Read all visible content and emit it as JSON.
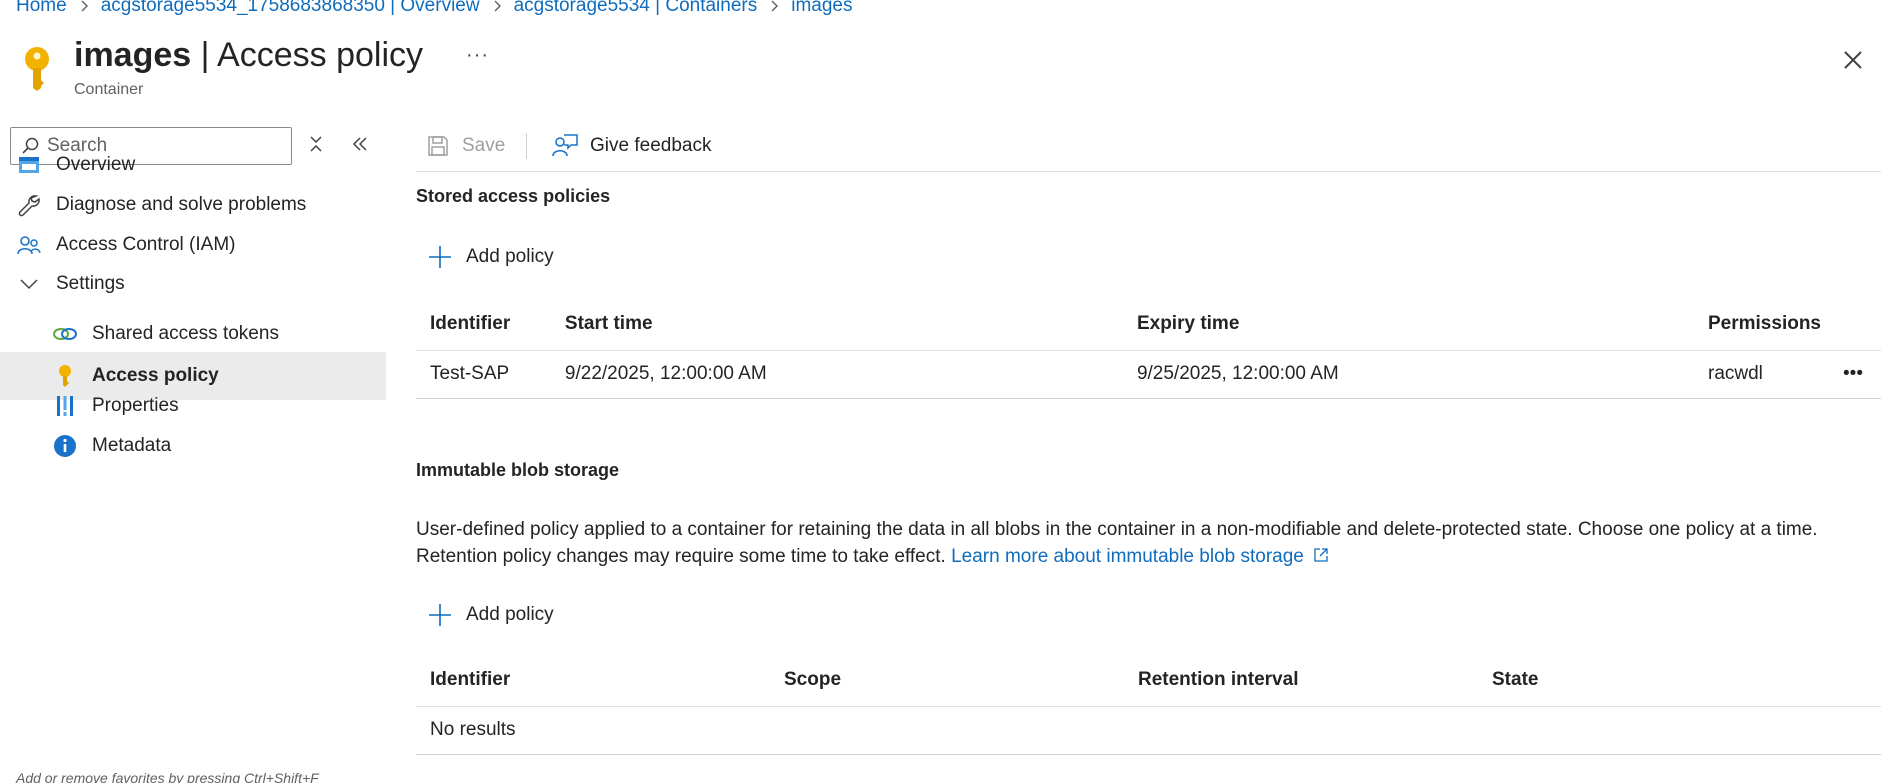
{
  "breadcrumb": {
    "items": [
      "Home",
      "acgstorage5534_1758683868350 | Overview",
      "acgstorage5534 | Containers",
      "images"
    ]
  },
  "header": {
    "title_bold": "images",
    "title_rest": " | Access policy",
    "more": "···",
    "subtitle": "Container",
    "icon": "key-icon"
  },
  "sidebar": {
    "search_placeholder": "Search",
    "items": [
      {
        "label": "Overview",
        "icon": "overview-icon"
      },
      {
        "label": "Diagnose and solve problems",
        "icon": "wrench-icon"
      },
      {
        "label": "Access Control (IAM)",
        "icon": "people-icon"
      },
      {
        "label": "Settings",
        "icon": "chevron-down-icon"
      },
      {
        "label": "Shared access tokens",
        "icon": "link-icon"
      },
      {
        "label": "Access policy",
        "icon": "key-icon"
      },
      {
        "label": "Properties",
        "icon": "properties-icon"
      },
      {
        "label": "Metadata",
        "icon": "info-icon"
      }
    ],
    "favorites_hint": "Add or remove favorites by pressing Ctrl+Shift+F"
  },
  "toolbar": {
    "save_label": "Save",
    "feedback_label": "Give feedback"
  },
  "stored": {
    "title": "Stored access policies",
    "add_label": "Add policy",
    "columns": [
      "Identifier",
      "Start time",
      "Expiry time",
      "Permissions"
    ],
    "rows": [
      {
        "identifier": "Test-SAP",
        "start": "9/22/2025, 12:00:00 AM",
        "expiry": "9/25/2025, 12:00:00 AM",
        "permissions": "racwdl",
        "more": "•••"
      }
    ]
  },
  "immutable": {
    "title": "Immutable blob storage",
    "description": "User-defined policy applied to a container for retaining the data in all blobs in the container in a non-modifiable and delete-protected state. Choose one policy at a time. Retention policy changes may require some time to take effect.",
    "learn_more": "Learn more about immutable blob storage",
    "add_label": "Add policy",
    "columns": [
      "Identifier",
      "Scope",
      "Retention interval",
      "State"
    ],
    "empty": "No results"
  },
  "colors": {
    "link": "#0f6cbd",
    "active_bg": "#ebebeb",
    "key_yellow": "#f2b300"
  }
}
